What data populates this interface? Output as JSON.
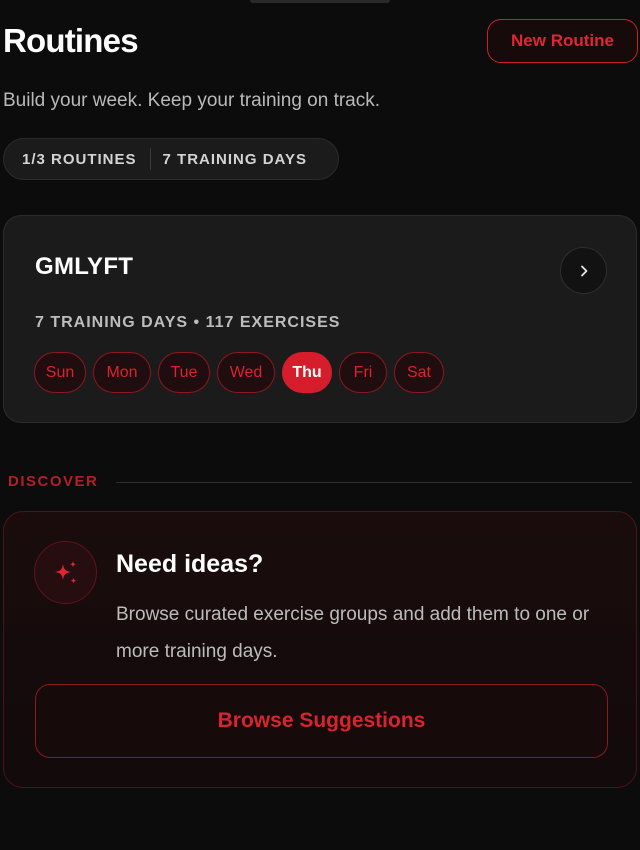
{
  "header": {
    "title": "Routines",
    "new_routine_label": "New Routine",
    "subtitle": "Build your week. Keep your training on track."
  },
  "stats": {
    "routines": "1/3 ROUTINES",
    "training_days": "7 TRAINING DAYS"
  },
  "routine": {
    "name": "GMLYFT",
    "meta": "7 TRAINING DAYS • 117 EXERCISES",
    "days": [
      {
        "label": "Sun",
        "active": false
      },
      {
        "label": "Mon",
        "active": false
      },
      {
        "label": "Tue",
        "active": false
      },
      {
        "label": "Wed",
        "active": false
      },
      {
        "label": "Thu",
        "active": true
      },
      {
        "label": "Fri",
        "active": false
      },
      {
        "label": "Sat",
        "active": false
      }
    ]
  },
  "discover": {
    "label": "DISCOVER",
    "title": "Need ideas?",
    "description": "Browse curated exercise groups and add them to one or more training days.",
    "button_label": "Browse Suggestions",
    "icon": "sparkles-icon"
  },
  "colors": {
    "accent": "#d51d2b",
    "background": "#0c0c0c",
    "card": "#1b1b1b"
  }
}
